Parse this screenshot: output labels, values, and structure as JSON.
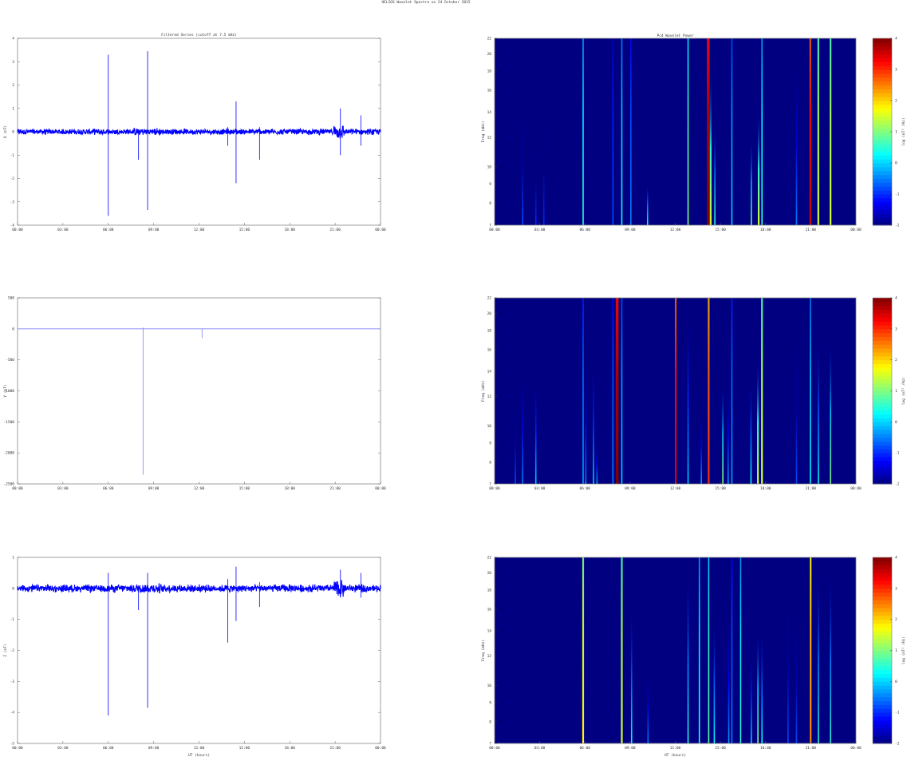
{
  "figure_title": "HELIOS Wavelet Spectra on 24 October 2015",
  "colors": {
    "series": "#0000ff",
    "series_light": "#8080ff",
    "axis": "#888888"
  },
  "chart_data": [
    {
      "type": "line",
      "id": "x-series",
      "title": "Filtered Series (cutoff at 7.5 mHz)",
      "ylabel": "X (nT)",
      "xlabel": "",
      "xlim": [
        0,
        24
      ],
      "ylim": [
        -4,
        4
      ],
      "xticks": [
        "00:00",
        "03:00",
        "06:00",
        "09:00",
        "12:00",
        "15:00",
        "18:00",
        "21:00",
        "00:00"
      ],
      "yticks": [
        4,
        3,
        2,
        1,
        0,
        -1,
        -2,
        -3,
        -4
      ],
      "noise_amplitude": 0.1,
      "spikes": [
        [
          6.0,
          3.3,
          -3.6
        ],
        [
          8.0,
          0.1,
          -1.2
        ],
        [
          8.6,
          3.45,
          -3.35
        ],
        [
          13.9,
          0.2,
          -0.6
        ],
        [
          14.45,
          1.3,
          -2.2
        ],
        [
          16.0,
          0.2,
          -1.2
        ],
        [
          21.35,
          1.0,
          -1.0
        ],
        [
          22.7,
          0.7,
          -0.6
        ]
      ]
    },
    {
      "type": "line",
      "id": "y-series",
      "title": "",
      "ylabel": "Y (nT)",
      "xlabel": "",
      "xlim": [
        0,
        24
      ],
      "ylim": [
        -2500,
        500
      ],
      "xticks": [
        "00:00",
        "03:00",
        "06:00",
        "09:00",
        "12:00",
        "15:00",
        "18:00",
        "21:00",
        "00:00"
      ],
      "yticks": [
        500,
        0,
        -500,
        -1000,
        -1500,
        -2000,
        -2500
      ],
      "noise_amplitude": 0,
      "spikes": [
        [
          8.3,
          20,
          -2350
        ],
        [
          12.2,
          0,
          -150
        ]
      ]
    },
    {
      "type": "line",
      "id": "z-series",
      "title": "",
      "ylabel": "Z (nT)",
      "xlabel": "UT (hours)",
      "xlim": [
        0,
        24
      ],
      "ylim": [
        -5,
        1
      ],
      "xticks": [
        "00:00",
        "03:00",
        "06:00",
        "09:00",
        "12:00",
        "15:00",
        "18:00",
        "21:00",
        "00:00"
      ],
      "yticks": [
        1,
        0,
        -1,
        -2,
        -3,
        -4,
        -5
      ],
      "noise_amplitude": 0.1,
      "spikes": [
        [
          6.0,
          0.5,
          -4.1
        ],
        [
          8.0,
          0.1,
          -0.7
        ],
        [
          8.6,
          0.5,
          -3.85
        ],
        [
          13.9,
          0.3,
          -1.75
        ],
        [
          14.45,
          0.7,
          -1.05
        ],
        [
          16.0,
          0.2,
          -0.6
        ],
        [
          21.35,
          0.6,
          -0.3
        ],
        [
          22.7,
          0.5,
          -0.3
        ]
      ]
    },
    {
      "type": "heatmap",
      "id": "x-wavelet",
      "title": "Pc4 Wavelet Power",
      "ylabel": "Freq (mHz)",
      "xlabel": "",
      "xlim": [
        0,
        24
      ],
      "ylim": [
        7,
        22
      ],
      "yscale": "log",
      "xticks": [
        "00:00",
        "03:00",
        "06:00",
        "09:00",
        "12:00",
        "15:00",
        "18:00",
        "21:00",
        "00:00"
      ],
      "yticks": [
        22,
        20,
        18,
        16,
        14,
        12,
        10,
        9,
        8,
        7
      ],
      "colorbar": {
        "label": "log (nT² /Hz)",
        "ticks": [
          4,
          3,
          2,
          1,
          0,
          -1,
          -2
        ],
        "range": [
          -2,
          4
        ]
      },
      "streaks": [
        [
          1.86,
          -0.8,
          14
        ],
        [
          2.74,
          -1,
          12
        ],
        [
          3.27,
          -1,
          14
        ],
        [
          5.88,
          0.5,
          22
        ],
        [
          7.86,
          -0.8,
          22
        ],
        [
          8.45,
          0.3,
          22
        ],
        [
          9.05,
          -0.5,
          22
        ],
        [
          10.16,
          0.5,
          9
        ],
        [
          12.85,
          1.0,
          22
        ],
        [
          14.19,
          4.0,
          22
        ],
        [
          14.35,
          1.5,
          18
        ],
        [
          14.63,
          0.5,
          13
        ],
        [
          15.76,
          0,
          22
        ],
        [
          17.05,
          0.8,
          12
        ],
        [
          17.54,
          1.5,
          14
        ],
        [
          17.76,
          0.5,
          22
        ],
        [
          20.05,
          -0.5,
          19
        ],
        [
          20.97,
          3.5,
          22
        ],
        [
          21.5,
          1.5,
          22
        ],
        [
          22.31,
          1.5,
          22
        ]
      ]
    },
    {
      "type": "heatmap",
      "id": "y-wavelet",
      "title": "",
      "ylabel": "Freq (mHz)",
      "xlabel": "",
      "xlim": [
        0,
        24
      ],
      "ylim": [
        7,
        22
      ],
      "yscale": "log",
      "xticks": [
        "00:00",
        "03:00",
        "06:00",
        "09:00",
        "12:00",
        "15:00",
        "18:00",
        "21:00",
        "00:00"
      ],
      "yticks": [
        22,
        20,
        18,
        16,
        14,
        12,
        10,
        9,
        8,
        7
      ],
      "colorbar": {
        "label": "log (nT² /Hz)",
        "ticks": [
          4,
          3,
          2,
          1,
          0,
          -1,
          -2
        ],
        "range": [
          -2,
          4
        ]
      },
      "streaks": [
        [
          1.38,
          -0.8,
          11
        ],
        [
          1.86,
          -0.5,
          14
        ],
        [
          2.74,
          0,
          13
        ],
        [
          5.88,
          -0.3,
          22
        ],
        [
          6.06,
          -0.5,
          15
        ],
        [
          6.57,
          0,
          15
        ],
        [
          6.8,
          -0.3,
          9
        ],
        [
          7.86,
          -0.5,
          22
        ],
        [
          8.14,
          4.0,
          22
        ],
        [
          8.45,
          0,
          22
        ],
        [
          12.03,
          3.5,
          22
        ],
        [
          12.85,
          0,
          20
        ],
        [
          13.73,
          -0.3,
          11
        ],
        [
          14.22,
          3.0,
          22
        ],
        [
          15.16,
          1.0,
          13
        ],
        [
          15.51,
          -0.3,
          13
        ],
        [
          15.76,
          -0.3,
          22
        ],
        [
          17.03,
          0.3,
          13
        ],
        [
          17.49,
          1.5,
          15
        ],
        [
          17.76,
          1.5,
          22
        ],
        [
          20.05,
          -0.8,
          17
        ],
        [
          20.97,
          0.3,
          22
        ],
        [
          21.5,
          0.3,
          17
        ],
        [
          22.31,
          1.0,
          17
        ]
      ]
    },
    {
      "type": "heatmap",
      "id": "z-wavelet",
      "title": "",
      "ylabel": "Freq (mHz)",
      "xlabel": "UT (hours)",
      "xlim": [
        0,
        24
      ],
      "ylim": [
        7,
        22
      ],
      "yscale": "log",
      "xticks": [
        "00:00",
        "03:00",
        "06:00",
        "09:00",
        "12:00",
        "15:00",
        "18:00",
        "21:00",
        "00:00"
      ],
      "yticks": [
        22,
        20,
        18,
        16,
        14,
        12,
        10,
        9,
        8,
        7
      ],
      "colorbar": {
        "label": "log (nT² /Hz)",
        "ticks": [
          4,
          3,
          2,
          1,
          0,
          -1,
          -2
        ],
        "range": [
          -2,
          4
        ]
      },
      "streaks": [
        [
          5.88,
          1.8,
          22
        ],
        [
          8.45,
          1.5,
          22
        ],
        [
          9.1,
          0.3,
          16
        ],
        [
          10.19,
          -0.5,
          11
        ],
        [
          12.85,
          0.5,
          20
        ],
        [
          13.6,
          0.5,
          22
        ],
        [
          14.22,
          0.8,
          22
        ],
        [
          14.59,
          0.3,
          15
        ],
        [
          15.55,
          -0.3,
          15
        ],
        [
          15.76,
          -0.5,
          22
        ],
        [
          16.34,
          0.5,
          22
        ],
        [
          17.05,
          0,
          12
        ],
        [
          17.49,
          1.0,
          14
        ],
        [
          17.76,
          0.3,
          14
        ],
        [
          19.49,
          -0.8,
          17
        ],
        [
          20.05,
          -0.8,
          15
        ],
        [
          20.99,
          2.5,
          22
        ],
        [
          21.5,
          0.5,
          20
        ],
        [
          22.31,
          0.5,
          20
        ]
      ]
    }
  ]
}
